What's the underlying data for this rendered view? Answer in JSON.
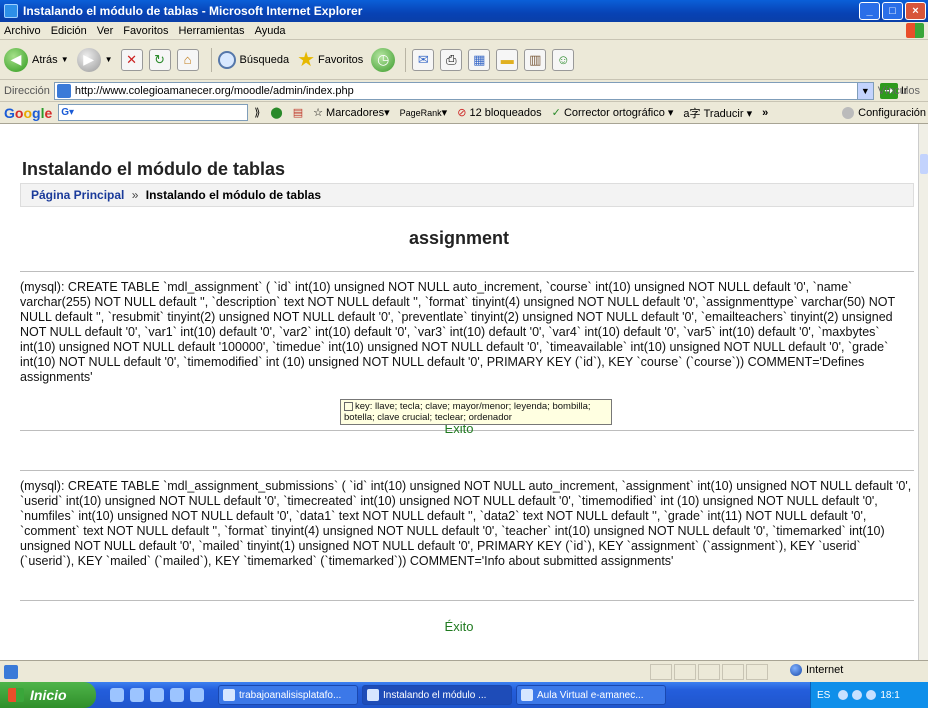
{
  "window": {
    "title": "Instalando el módulo de tablas - Microsoft Internet Explorer"
  },
  "menu": [
    "Archivo",
    "Edición",
    "Ver",
    "Favoritos",
    "Herramientas",
    "Ayuda"
  ],
  "toolbar": {
    "back": "Atrás",
    "search": "Búsqueda",
    "favorites": "Favoritos"
  },
  "address": {
    "label": "Dirección",
    "url": "http://www.colegioamanecer.org/moodle/admin/index.php",
    "go": "Ir",
    "links": "Vínculos"
  },
  "google": {
    "bookmarks": "Marcadores",
    "pagerank": "PageRank",
    "blocked": "12 bloqueados",
    "spell": "Corrector ortográfico",
    "translate": "Traducir",
    "more": "»",
    "settings": "Configuración"
  },
  "page": {
    "heading": "Instalando el módulo de tablas",
    "breadcrumb_home": "Página Principal",
    "breadcrumb_sep": "»",
    "breadcrumb_current": "Instalando el módulo de tablas",
    "section": "assignment",
    "sql1": "(mysql): CREATE TABLE `mdl_assignment` ( `id` int(10) unsigned NOT NULL auto_increment, `course` int(10) unsigned NOT NULL default '0', `name` varchar(255) NOT NULL default '', `description` text NOT NULL default '', `format` tinyint(4) unsigned NOT NULL default '0', `assignmenttype` varchar(50) NOT NULL default '', `resubmit` tinyint(2) unsigned NOT NULL default '0', `preventlate` tinyint(2) unsigned NOT NULL default '0', `emailteachers` tinyint(2) unsigned NOT NULL default '0', `var1` int(10) default '0', `var2` int(10) default '0', `var3` int(10) default '0', `var4` int(10) default '0', `var5` int(10) default '0', `maxbytes` int(10) unsigned NOT NULL default '100000', `timedue` int(10) unsigned NOT NULL default '0', `timeavailable` int(10) unsigned NOT NULL default '0', `grade` int(10) NOT NULL default '0', `timemodified` int (10) unsigned NOT NULL default '0', PRIMARY KEY (`id`), KEY `course` (`course`)) COMMENT='Defines assignments'",
    "result1": "Éxito",
    "sql2": "(mysql): CREATE TABLE `mdl_assignment_submissions` ( `id` int(10) unsigned NOT NULL auto_increment, `assignment` int(10) unsigned NOT NULL default '0', `userid` int(10) unsigned NOT NULL default '0', `timecreated` int(10) unsigned NOT NULL default '0', `timemodified` int (10) unsigned NOT NULL default '0', `numfiles` int(10) unsigned NOT NULL default '0', `data1` text NOT NULL default '', `data2` text NOT NULL default '', `grade` int(11) NOT NULL default '0', `comment` text NOT NULL default '', `format` tinyint(4) unsigned NOT NULL default '0', `teacher` int(10) unsigned NOT NULL default '0', `timemarked` int(10) unsigned NOT NULL default '0', `mailed` tinyint(1) unsigned NOT NULL default '0', PRIMARY KEY (`id`), KEY `assignment` (`assignment`), KEY `userid` (`userid`), KEY `mailed` (`mailed`), KEY `timemarked` (`timemarked`)) COMMENT='Info about submitted assignments'",
    "result2": "Éxito"
  },
  "tooltip": {
    "text": "key: llave; tecla; clave; mayor/menor; leyenda; bombilla; botella; clave crucial; teclear; ordenador"
  },
  "status": {
    "zone": "Internet"
  },
  "taskbar": {
    "start": "Inicio",
    "tasks": [
      "trabajoanalisisplatafo...",
      "Instalando el módulo ...",
      "Aula Virtual e-amanec..."
    ],
    "lang": "ES",
    "clock": "18:1"
  }
}
